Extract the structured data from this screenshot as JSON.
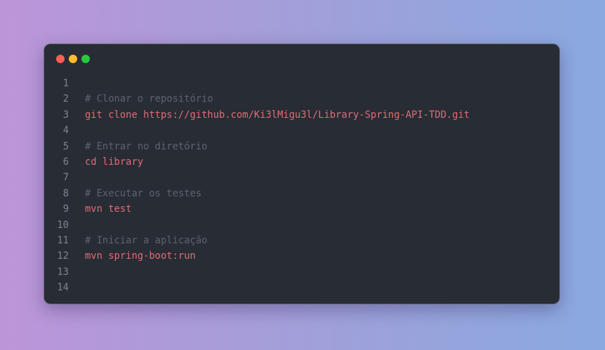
{
  "colors": {
    "red_dot": "#ff5f56",
    "yellow_dot": "#ffbd2e",
    "green_dot": "#27c93f",
    "comment": "#5c6370",
    "command": "#e06c75",
    "line_number": "#7f848e"
  },
  "window_controls": [
    "close",
    "minimize",
    "maximize"
  ],
  "code_lines": [
    {
      "n": "1",
      "text": "",
      "kind": "blank"
    },
    {
      "n": "2",
      "text": "# Clonar o repositório",
      "kind": "comment"
    },
    {
      "n": "3",
      "text": "git clone https://github.com/Ki3lMigu3l/Library-Spring-API-TDD.git",
      "kind": "command"
    },
    {
      "n": "4",
      "text": "",
      "kind": "blank"
    },
    {
      "n": "5",
      "text": "# Entrar no diretório",
      "kind": "comment"
    },
    {
      "n": "6",
      "text": "cd library",
      "kind": "command"
    },
    {
      "n": "7",
      "text": "",
      "kind": "blank"
    },
    {
      "n": "8",
      "text": "# Executar os testes",
      "kind": "comment"
    },
    {
      "n": "9",
      "text": "mvn test",
      "kind": "command"
    },
    {
      "n": "10",
      "text": "",
      "kind": "blank"
    },
    {
      "n": "11",
      "text": "# Iniciar a aplicação",
      "kind": "comment"
    },
    {
      "n": "12",
      "text": "mvn spring-boot:run",
      "kind": "command"
    },
    {
      "n": "13",
      "text": "",
      "kind": "blank"
    },
    {
      "n": "14",
      "text": "",
      "kind": "blank"
    }
  ]
}
